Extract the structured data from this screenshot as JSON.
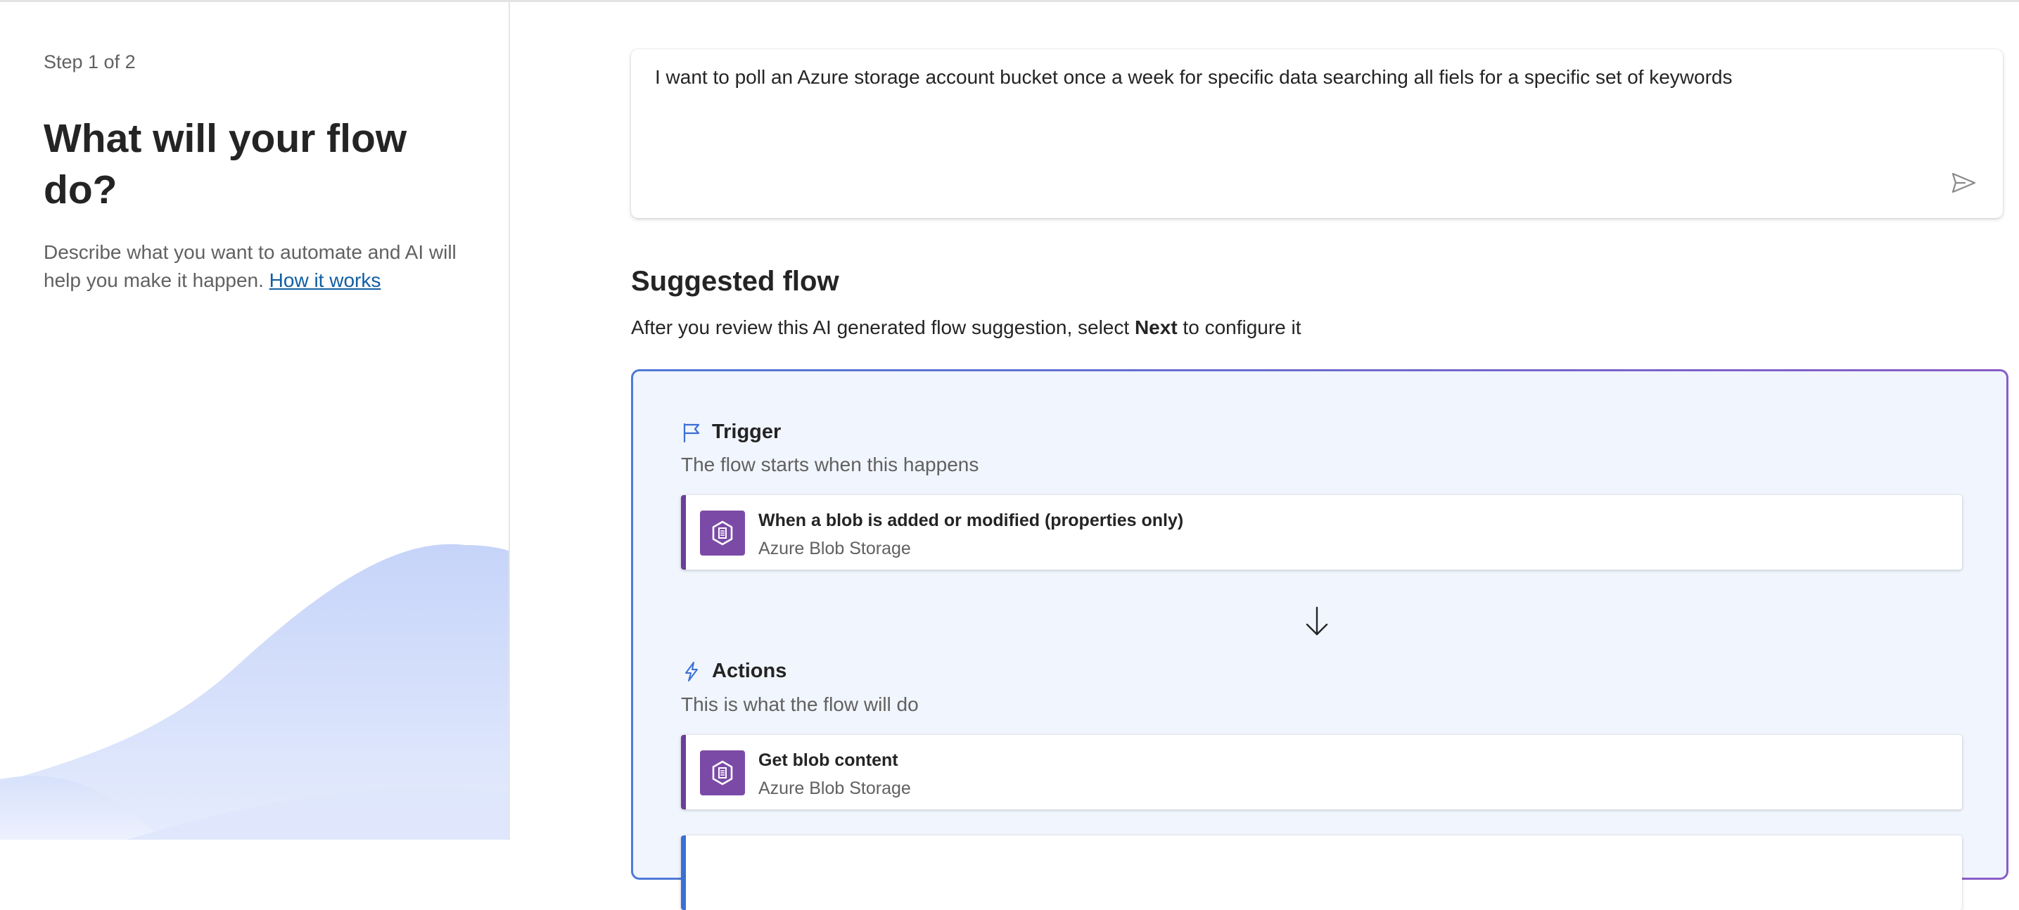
{
  "left": {
    "step": "Step 1 of 2",
    "heading": "What will your flow do?",
    "description": "Describe what you want to automate and AI will help you make it happen.",
    "link": "How it works"
  },
  "prompt": {
    "text": "I want to poll an Azure storage account bucket once a week for specific data searching all fiels for a specific set of keywords",
    "send_icon": "send-icon"
  },
  "suggested": {
    "title": "Suggested flow",
    "subtitle_pre": "After you review this AI generated flow suggestion, select ",
    "subtitle_bold": "Next",
    "subtitle_post": " to configure it",
    "trigger": {
      "label": "Trigger",
      "icon": "flag-icon",
      "desc": "The flow starts when this happens",
      "step": {
        "title": "When a blob is added or modified (properties only)",
        "connector": "Azure Blob Storage",
        "icon": "azure-blob-storage-icon"
      }
    },
    "actions": {
      "label": "Actions",
      "icon": "lightning-icon",
      "desc": "This is what the flow will do",
      "steps": [
        {
          "title": "Get blob content",
          "connector": "Azure Blob Storage",
          "icon": "azure-blob-storage-icon"
        }
      ]
    }
  },
  "colors": {
    "accent_purple": "#7b4aa6",
    "accent_blue": "#4f79d6",
    "card_bg": "#f1f5fd",
    "link": "#115ea3"
  }
}
